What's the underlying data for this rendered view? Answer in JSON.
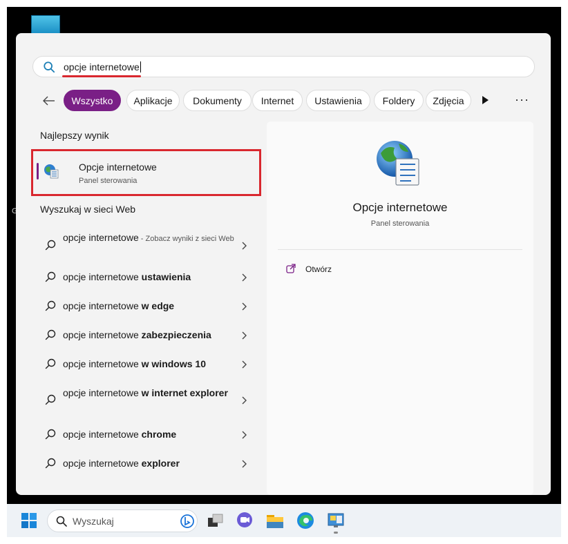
{
  "search": {
    "query": "opcje internetowe"
  },
  "filters": [
    {
      "label": "Wszystko",
      "active": true
    },
    {
      "label": "Aplikacje",
      "active": false
    },
    {
      "label": "Dokumenty",
      "active": false
    },
    {
      "label": "Internet",
      "active": false
    },
    {
      "label": "Ustawienia",
      "active": false
    },
    {
      "label": "Foldery",
      "active": false
    },
    {
      "label": "Zdjęcia",
      "active": false
    }
  ],
  "best_match": {
    "section_title": "Najlepszy wynik",
    "title": "Opcje internetowe",
    "subtitle": "Panel sterowania"
  },
  "web_search": {
    "section_title": "Wyszukaj w sieci Web",
    "items": [
      {
        "base": "opcje internetowe",
        "bold": "",
        "hint": " - Zobacz wyniki z sieci Web"
      },
      {
        "base": "opcje internetowe ",
        "bold": "ustawienia",
        "hint": ""
      },
      {
        "base": "opcje internetowe ",
        "bold": "w edge",
        "hint": ""
      },
      {
        "base": "opcje internetowe ",
        "bold": "zabezpieczenia",
        "hint": ""
      },
      {
        "base": "opcje internetowe ",
        "bold": "w windows 10",
        "hint": ""
      },
      {
        "base": "opcje internetowe ",
        "bold": "w internet explorer",
        "hint": ""
      },
      {
        "base": "opcje internetowe ",
        "bold": "chrome",
        "hint": ""
      },
      {
        "base": "opcje internetowe ",
        "bold": "explorer",
        "hint": ""
      }
    ]
  },
  "details": {
    "title": "Opcje internetowe",
    "subtitle": "Panel sterowania",
    "actions": [
      {
        "label": "Otwórz",
        "icon": "open-external-icon"
      }
    ]
  },
  "taskbar": {
    "search_placeholder": "Wyszukaj",
    "apps": [
      "task-view-icon",
      "chat-icon",
      "file-explorer-icon",
      "edge-icon",
      "control-panel-icon"
    ]
  },
  "colors": {
    "accent": "#7a1f86",
    "highlight_box": "#d9272e"
  }
}
